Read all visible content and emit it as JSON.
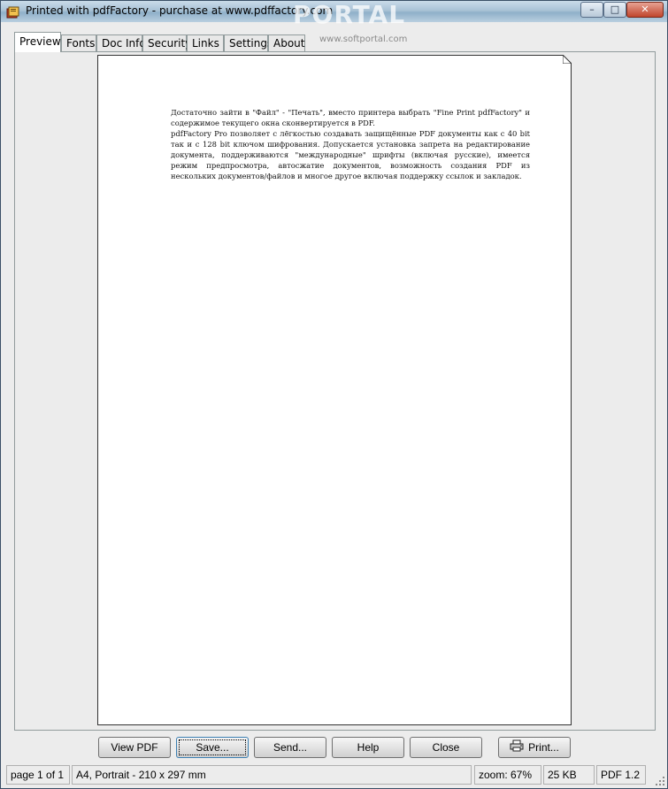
{
  "window": {
    "title": "Printed with pdfFactory - purchase at www.pdffactory.com",
    "watermark": "PORTAL",
    "watermark_sub": "www.softportal.com",
    "controls": {
      "minimize": "–",
      "maximize": "□",
      "close": "✕"
    }
  },
  "tabs": [
    {
      "label": "Preview",
      "active": true
    },
    {
      "label": "Fonts"
    },
    {
      "label": "Doc Info"
    },
    {
      "label": "Security"
    },
    {
      "label": "Links"
    },
    {
      "label": "Settings"
    },
    {
      "label": "About"
    }
  ],
  "document": {
    "paragraphs": [
      "Достаточно зайти в \"Файл\" - \"Печать\", вместо принтера выбрать \"Fine Print pdfFactory\" и содержимое текущего окна сконвертируется в PDF.",
      "pdfFactory Pro позволяет с лёгкостью создавать защищённые PDF документы как с 40 bit так и с 128 bit ключом шифрования. Допускается установка запрета на редактирование документа, поддерживаются \"международные\" шрифты (включая русские), имеется режим предпросмотра, автосжатие документов, возможность создания PDF из нескольких документов/файлов и многое другое включая поддержку ссылок и закладок."
    ]
  },
  "buttons": {
    "view_pdf": "View PDF",
    "save": "Save...",
    "send": "Send...",
    "help": "Help",
    "close": "Close",
    "print": "Print..."
  },
  "status": {
    "page": "page 1 of 1",
    "paper": "A4, Portrait - 210 x 297 mm",
    "zoom": "zoom: 67%",
    "size": "25 KB",
    "pdf_version": "PDF 1.2"
  }
}
